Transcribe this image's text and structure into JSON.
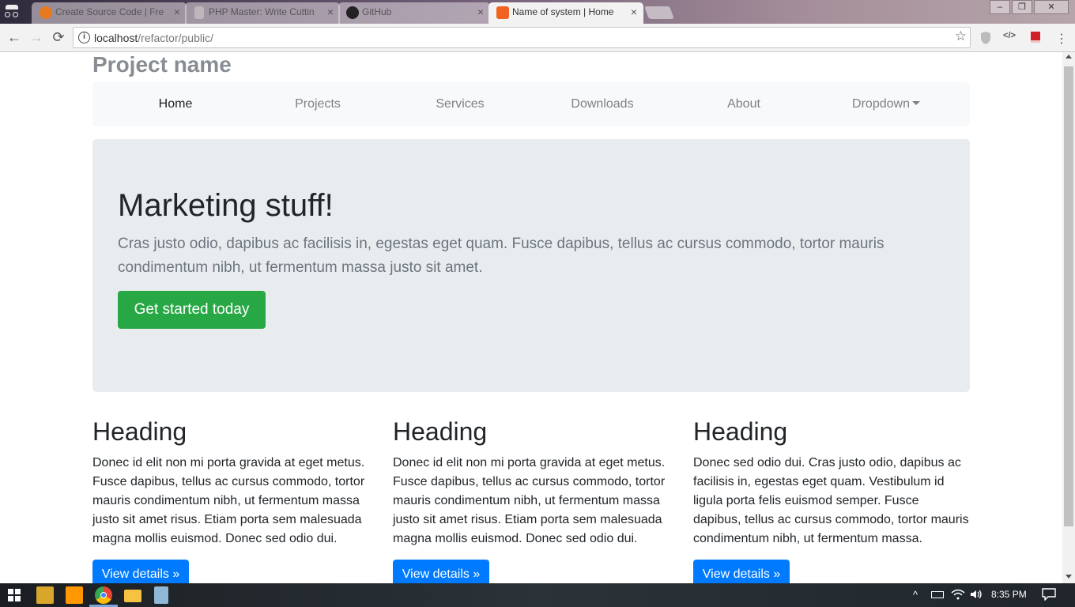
{
  "browser": {
    "tabs": [
      {
        "title": "Create Source Code | Fre",
        "state": "inactive",
        "icon": "source-code-favicon",
        "icon_color": "#e8791c"
      },
      {
        "title": "PHP Master: Write Cuttin",
        "state": "inactive",
        "icon": "document-favicon",
        "icon_color": "#bdb6ba"
      },
      {
        "title": "GitHub",
        "state": "inactive",
        "icon": "github-favicon",
        "icon_color": "#222222"
      },
      {
        "title": "Name of system | Home",
        "state": "active",
        "icon": "xampp-favicon",
        "icon_color": "#f26322"
      }
    ],
    "close_glyph": "×",
    "window_controls": {
      "minimize": "–",
      "maximize": "❐",
      "close": "✕"
    },
    "nav": {
      "back": "←",
      "forward": "→",
      "reload": "⟳"
    },
    "url": {
      "host": "localhost",
      "path": "/refactor/public/"
    },
    "star": "☆"
  },
  "site": {
    "brand": "Project name",
    "nav": [
      {
        "label": "Home",
        "active": true
      },
      {
        "label": "Projects",
        "active": false
      },
      {
        "label": "Services",
        "active": false
      },
      {
        "label": "Downloads",
        "active": false
      },
      {
        "label": "About",
        "active": false
      },
      {
        "label": "Dropdown",
        "active": false,
        "dropdown": true
      }
    ],
    "jumbotron": {
      "heading": "Marketing stuff!",
      "lead": "Cras justo odio, dapibus ac facilisis in, egestas eget quam. Fusce dapibus, tellus ac cursus commodo, tortor mauris condimentum nibh, ut fermentum massa justo sit amet.",
      "button": "Get started today"
    },
    "columns": [
      {
        "heading": "Heading",
        "text": "Donec id elit non mi porta gravida at eget metus. Fusce dapibus, tellus ac cursus commodo, tortor mauris condimentum nibh, ut fermentum massa justo sit amet risus. Etiam porta sem malesuada magna mollis euismod. Donec sed odio dui.",
        "button": "View details »"
      },
      {
        "heading": "Heading",
        "text": "Donec id elit non mi porta gravida at eget metus. Fusce dapibus, tellus ac cursus commodo, tortor mauris condimentum nibh, ut fermentum massa justo sit amet risus. Etiam porta sem malesuada magna mollis euismod. Donec sed odio dui.",
        "button": "View details »"
      },
      {
        "heading": "Heading",
        "text": "Donec sed odio dui. Cras justo odio, dapibus ac facilisis in, egestas eget quam. Vestibulum id ligula porta felis euismod semper. Fusce dapibus, tellus ac cursus commodo, tortor mauris condimentum nibh, ut fermentum massa.",
        "button": "View details »"
      }
    ]
  },
  "colors": {
    "success": "#28a745",
    "primary": "#007bff",
    "jumbotron_bg": "#e9ecef",
    "navbar_bg": "#f8f9fa"
  },
  "taskbar": {
    "apps": [
      {
        "name": "file-zilla-icon",
        "color": "#d8a62a"
      },
      {
        "name": "sublime-text-icon",
        "color": "#ff9800"
      },
      {
        "name": "chrome-icon",
        "color": "#4285f4"
      },
      {
        "name": "file-explorer-icon",
        "color": "#f5c242"
      },
      {
        "name": "notepad-icon",
        "color": "#8fb8d8"
      }
    ],
    "tray": {
      "chevron": "^",
      "clock": "8:35 PM"
    }
  }
}
